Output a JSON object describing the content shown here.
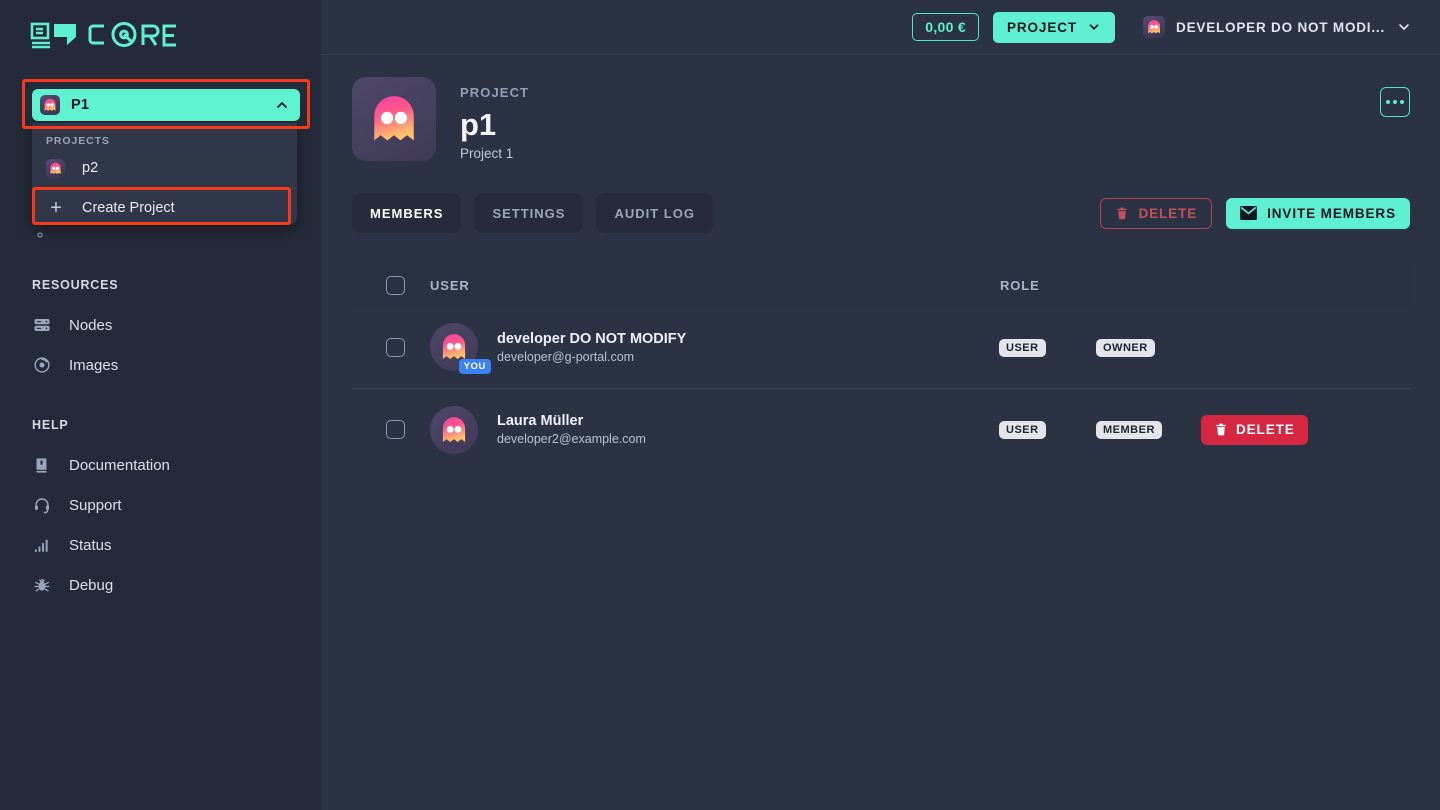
{
  "brand": {
    "logo_text": "CORE"
  },
  "colors": {
    "accent": "#5fefd2",
    "sidebar_bg": "#242a39",
    "main_bg": "#2b3243",
    "highlight_outline": "#f93a1a",
    "danger": "#d52742",
    "badge_blue": "#3b82f6"
  },
  "sidebar": {
    "project_selector": {
      "label": "P1",
      "icon": "ghost-icon",
      "chevron": "chevron-up-icon",
      "expanded": true
    },
    "dropdown": {
      "heading": "PROJECTS",
      "projects": [
        {
          "label": "p2",
          "icon": "ghost-icon"
        }
      ],
      "create": {
        "label": "Create Project",
        "icon": "plus-icon"
      }
    },
    "obscured_item": {
      "label": ""
    },
    "sections": [
      {
        "heading": "RESOURCES",
        "items": [
          {
            "label": "Nodes",
            "icon": "server-icon"
          },
          {
            "label": "Images",
            "icon": "disc-icon"
          }
        ]
      },
      {
        "heading": "HELP",
        "items": [
          {
            "label": "Documentation",
            "icon": "book-icon"
          },
          {
            "label": "Support",
            "icon": "headset-icon"
          },
          {
            "label": "Status",
            "icon": "bar-chart-icon"
          },
          {
            "label": "Debug",
            "icon": "bug-icon"
          }
        ]
      }
    ]
  },
  "topbar": {
    "credit": "0,00 €",
    "project_button": {
      "label": "PROJECT",
      "chevron": "chevron-down-icon"
    },
    "user_menu": {
      "name": "DEVELOPER DO NOT MODI...",
      "icon": "ghost-icon",
      "chevron": "chevron-down-icon"
    }
  },
  "project_header": {
    "kicker": "PROJECT",
    "title": "p1",
    "subtitle": "Project 1",
    "avatar_icon": "ghost-icon",
    "kebab": "more-options-icon"
  },
  "tabs": [
    {
      "label": "MEMBERS",
      "active": true
    },
    {
      "label": "SETTINGS",
      "active": false
    },
    {
      "label": "AUDIT LOG",
      "active": false
    }
  ],
  "header_actions": {
    "delete": {
      "label": "DELETE",
      "icon": "trash-icon"
    },
    "invite": {
      "label": "INVITE MEMBERS",
      "icon": "envelope-icon"
    }
  },
  "table": {
    "columns": {
      "user": "USER",
      "role": "ROLE"
    },
    "rows": [
      {
        "name": "developer DO NOT MODIFY",
        "email": "developer@g-portal.com",
        "you_badge": "YOU",
        "type": "USER",
        "role": "OWNER",
        "action": null
      },
      {
        "name": "Laura Müller",
        "email": "developer2@example.com",
        "you_badge": null,
        "type": "USER",
        "role": "MEMBER",
        "action": {
          "label": "DELETE",
          "icon": "trash-icon"
        }
      }
    ]
  }
}
